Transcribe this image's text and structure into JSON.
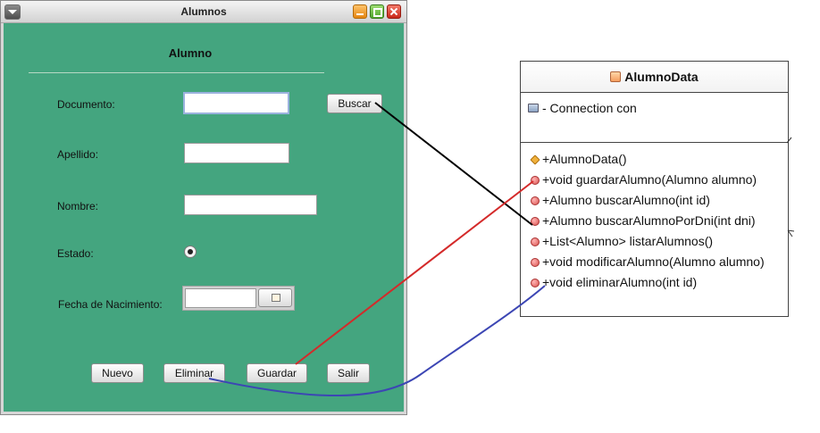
{
  "window": {
    "title": "Alumnos",
    "panel_title": "Alumno",
    "labels": {
      "documento": "Documento:",
      "apellido": "Apellido:",
      "nombre": "Nombre:",
      "estado": "Estado:",
      "fecha": "Fecha de Nacimiento:"
    },
    "buttons": {
      "buscar": "Buscar",
      "nuevo": "Nuevo",
      "eliminar": "Eliminar",
      "guardar": "Guardar",
      "salir": "Salir"
    },
    "fields": {
      "documento": "",
      "apellido": "",
      "nombre": "",
      "fecha": ""
    },
    "estado_checked": true
  },
  "uml": {
    "class_name": "AlumnoData",
    "attributes": [
      {
        "text": "- Connection con",
        "icon": "field-icon"
      }
    ],
    "methods": [
      {
        "text": "+AlumnoData()",
        "icon": "constructor-icon"
      },
      {
        "text": "+void guardarAlumno(Alumno alumno)",
        "icon": "method-icon"
      },
      {
        "text": "+Alumno buscarAlumno(int id)",
        "icon": "method-icon"
      },
      {
        "text": "+Alumno buscarAlumnoPorDni(int dni)",
        "icon": "method-icon"
      },
      {
        "text": "+List<Alumno> listarAlumnos()",
        "icon": "method-icon"
      },
      {
        "text": "+void modificarAlumno(Alumno alumno)",
        "icon": "method-icon"
      },
      {
        "text": "+void eliminarAlumno(int id)",
        "icon": "method-icon"
      }
    ]
  },
  "connectors": [
    {
      "from": "buscar-button",
      "to": "buscarAlumnoPorDni",
      "color": "#000000"
    },
    {
      "from": "guardar-button",
      "to": "guardarAlumno",
      "color": "#d42a2a"
    },
    {
      "from": "eliminar-button",
      "to": "eliminarAlumno",
      "color": "#3c46b4"
    }
  ]
}
